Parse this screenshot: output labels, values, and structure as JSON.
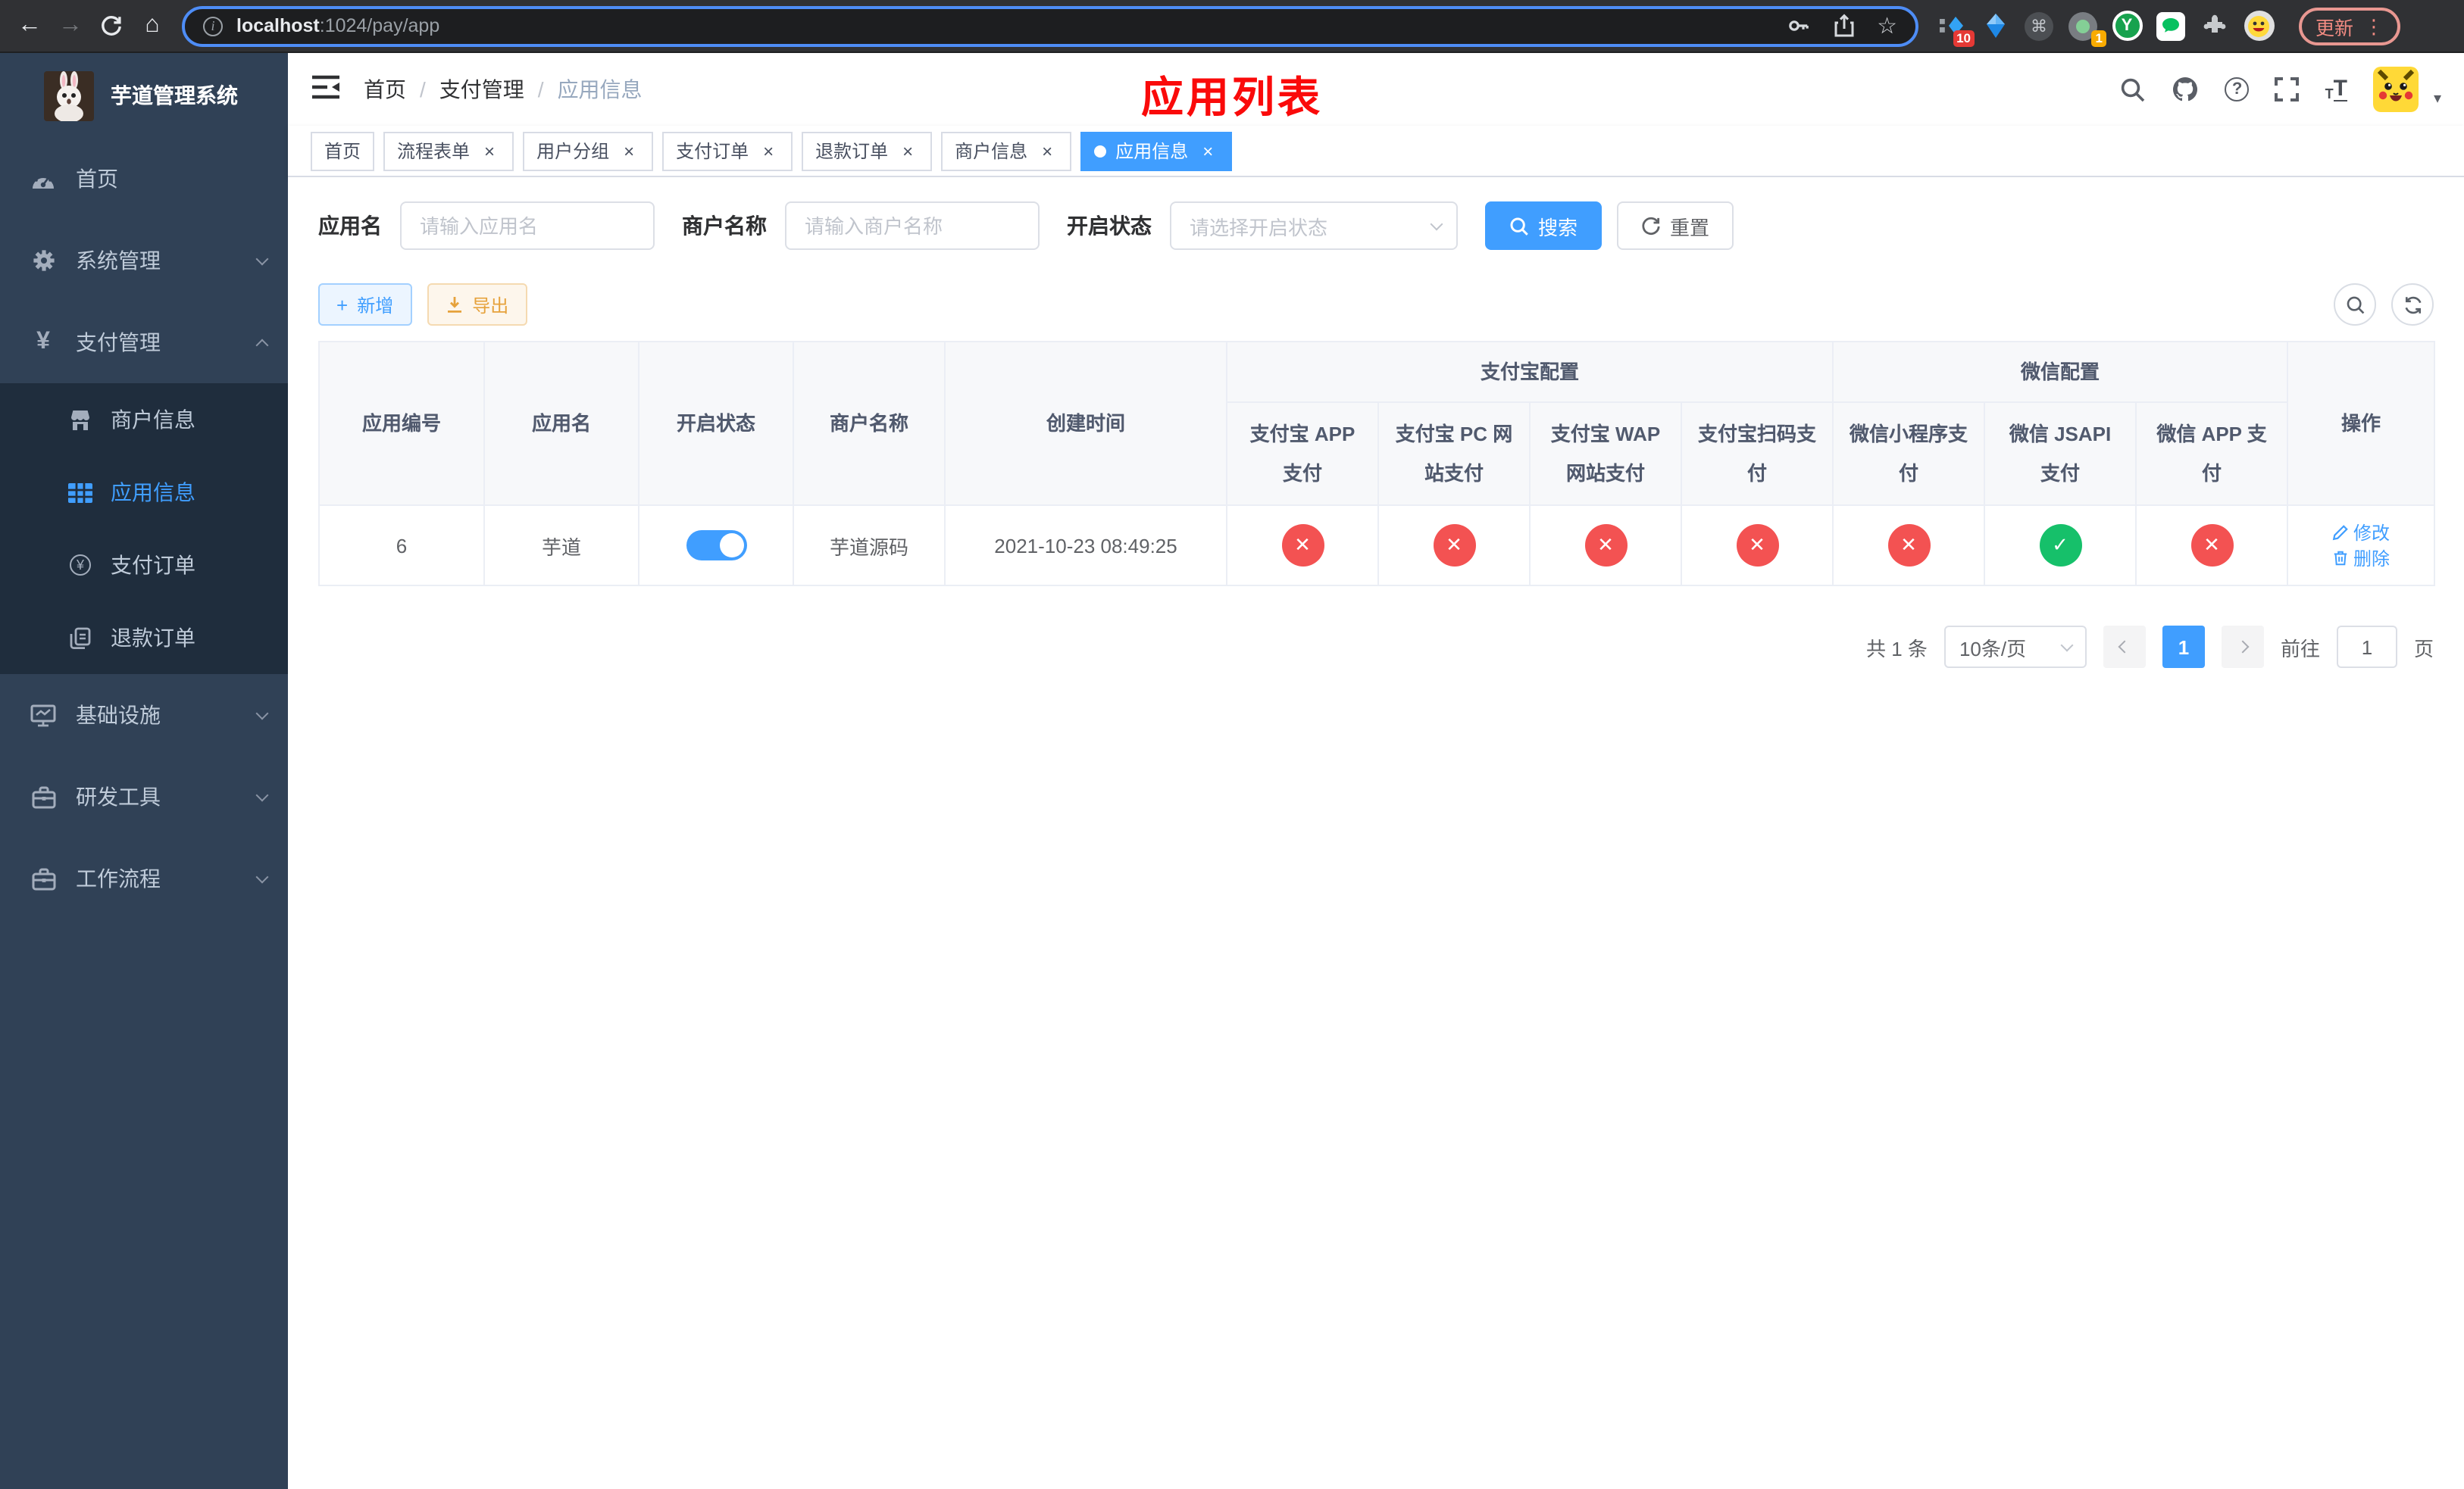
{
  "browser": {
    "url": {
      "host": "localhost",
      "path": ":1024/pay/app"
    },
    "update_label": "更新",
    "extension_badges": {
      "blue_ext": "10",
      "capture_ext": "1"
    },
    "y_ext_letter": "Y"
  },
  "icons": {
    "back": "←",
    "forward": "→",
    "home": "⌂",
    "star": "☆",
    "command": "⌘",
    "menu_dots": "⋮",
    "close": "×",
    "plus": "+",
    "caret_down": "▾",
    "yen": "¥",
    "info": "i",
    "question": "?",
    "check": "✓",
    "cross": "✕",
    "text_t": "T"
  },
  "sidebar": {
    "title": "芋道管理系统",
    "menu": [
      {
        "label": "首页"
      },
      {
        "label": "系统管理"
      },
      {
        "label": "支付管理"
      }
    ],
    "submenu": [
      {
        "label": "商户信息"
      },
      {
        "label": "应用信息"
      },
      {
        "label": "支付订单"
      },
      {
        "label": "退款订单"
      }
    ],
    "menu_bottom": [
      {
        "label": "基础设施"
      },
      {
        "label": "研发工具"
      },
      {
        "label": "工作流程"
      }
    ]
  },
  "header": {
    "breadcrumb": [
      "首页",
      "支付管理",
      "应用信息"
    ],
    "breadcrumb_sep": "/",
    "overlay_title": "应用列表"
  },
  "tabs": [
    {
      "label": "首页"
    },
    {
      "label": "流程表单"
    },
    {
      "label": "用户分组"
    },
    {
      "label": "支付订单"
    },
    {
      "label": "退款订单"
    },
    {
      "label": "商户信息"
    },
    {
      "label": "应用信息"
    }
  ],
  "filters": {
    "app_name": {
      "label": "应用名",
      "placeholder": "请输入应用名",
      "value": ""
    },
    "merchant_name": {
      "label": "商户名称",
      "placeholder": "请输入商户名称",
      "value": ""
    },
    "status": {
      "label": "开启状态",
      "placeholder": "请选择开启状态"
    },
    "search_label": "搜索",
    "reset_label": "重置"
  },
  "toolbar": {
    "add_label": "新增",
    "export_label": "导出"
  },
  "table": {
    "column_groups": {
      "alipay": "支付宝配置",
      "wechat": "微信配置"
    },
    "columns": {
      "id": "应用编号",
      "name": "应用名",
      "status": "开启状态",
      "merchant": "商户名称",
      "created": "创建时间",
      "alipay_app": "支付宝 APP 支付",
      "alipay_pc": "支付宝 PC 网站支付",
      "alipay_wap": "支付宝 WAP 网站支付",
      "alipay_qr": "支付宝扫码支付",
      "wx_mini": "微信小程序支付",
      "wx_jsapi": "微信 JSAPI 支付",
      "wx_app": "微信 APP 支付",
      "actions": "操作"
    },
    "rows": [
      {
        "id": "6",
        "name": "芋道",
        "enabled": true,
        "merchant": "芋道源码",
        "created": "2021-10-23 08:49:25",
        "statuses": [
          "no",
          "no",
          "no",
          "no",
          "no",
          "yes",
          "no"
        ],
        "edit_label": "修改",
        "delete_label": "删除"
      }
    ]
  },
  "pagination": {
    "total": "共 1 条",
    "page_size": "10条/页",
    "current": "1",
    "goto_label": "前往",
    "goto_value": "1",
    "unit_label": "页"
  },
  "colors": {
    "accent": "#409eff",
    "danger": "#f35252",
    "success": "#16c06a",
    "sidebar_bg": "#304156",
    "submenu_bg": "#1f2d3d",
    "title_red": "#fa0a0a",
    "warning": "#e6a23c"
  }
}
